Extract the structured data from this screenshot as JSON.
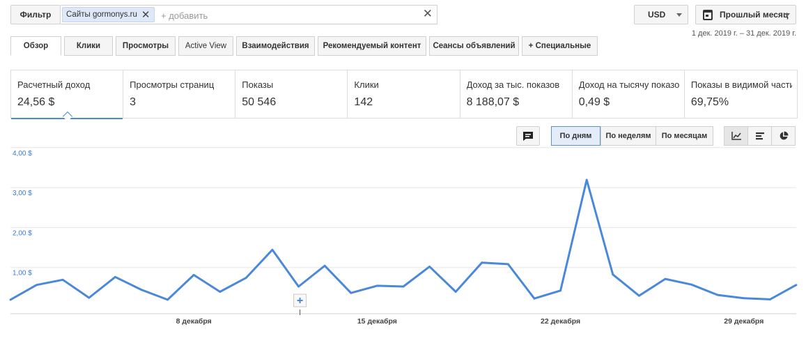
{
  "toolbar": {
    "filter_label": "Фильтр",
    "chip_label": "Сайты gormonys.ru",
    "add_placeholder": "+ добавить",
    "currency": "USD",
    "period": "Прошлый месяц",
    "date_range": "1 дек. 2019 г. – 31 дек. 2019 г."
  },
  "tabs": [
    "Обзор",
    "Клики",
    "Просмотры",
    "Active View",
    "Взаимодействия",
    "Рекомендуемый контент",
    "Сеансы объявлений",
    "+ Специальные"
  ],
  "metrics": [
    {
      "label": "Расчетный доход",
      "value": "24,56 $"
    },
    {
      "label": "Просмотры страниц",
      "value": "3"
    },
    {
      "label": "Показы",
      "value": "50 546"
    },
    {
      "label": "Клики",
      "value": "142"
    },
    {
      "label": "Доход за тыс. показов",
      "value": "8 188,07 $"
    },
    {
      "label": "Доход на тысячу показов",
      "value": "0,49 $"
    },
    {
      "label": "Показы в видимой части",
      "value": "69,75%"
    }
  ],
  "granularity": {
    "options": [
      "По дням",
      "По неделям",
      "По месяцам"
    ],
    "selected": "По дням"
  },
  "view_icons": [
    "line-chart-icon",
    "bar-chart-icon",
    "pie-chart-icon"
  ],
  "colors": {
    "accent": "#4a88da",
    "line": "#4a88da"
  },
  "chart_data": {
    "type": "line",
    "y_tick_labels": [
      "1,00 $",
      "2,00 $",
      "3,00 $",
      "4,00 $"
    ],
    "ylim": [
      0,
      4.2
    ],
    "x_tick_labels": [
      {
        "day": 8,
        "label": "8 декабря"
      },
      {
        "day": 15,
        "label": "15 декабря"
      },
      {
        "day": 22,
        "label": "22 декабря"
      },
      {
        "day": 29,
        "label": "29 декабря"
      }
    ],
    "series": [
      {
        "x": [
          1,
          2,
          3,
          4,
          5,
          6,
          7,
          8,
          9,
          10,
          11,
          12,
          13,
          14,
          15,
          16,
          17,
          18,
          19,
          20,
          21,
          22,
          23,
          24,
          25,
          26,
          27,
          28,
          29,
          30,
          31
        ],
        "values": [
          0.35,
          0.72,
          0.85,
          0.4,
          0.92,
          0.6,
          0.35,
          0.97,
          0.55,
          0.9,
          1.6,
          0.68,
          1.2,
          0.52,
          0.7,
          0.68,
          1.18,
          0.55,
          1.28,
          1.24,
          0.38,
          0.58,
          3.35,
          0.98,
          0.45,
          0.87,
          0.73,
          0.47,
          0.39,
          0.36,
          0.72
        ]
      }
    ]
  }
}
